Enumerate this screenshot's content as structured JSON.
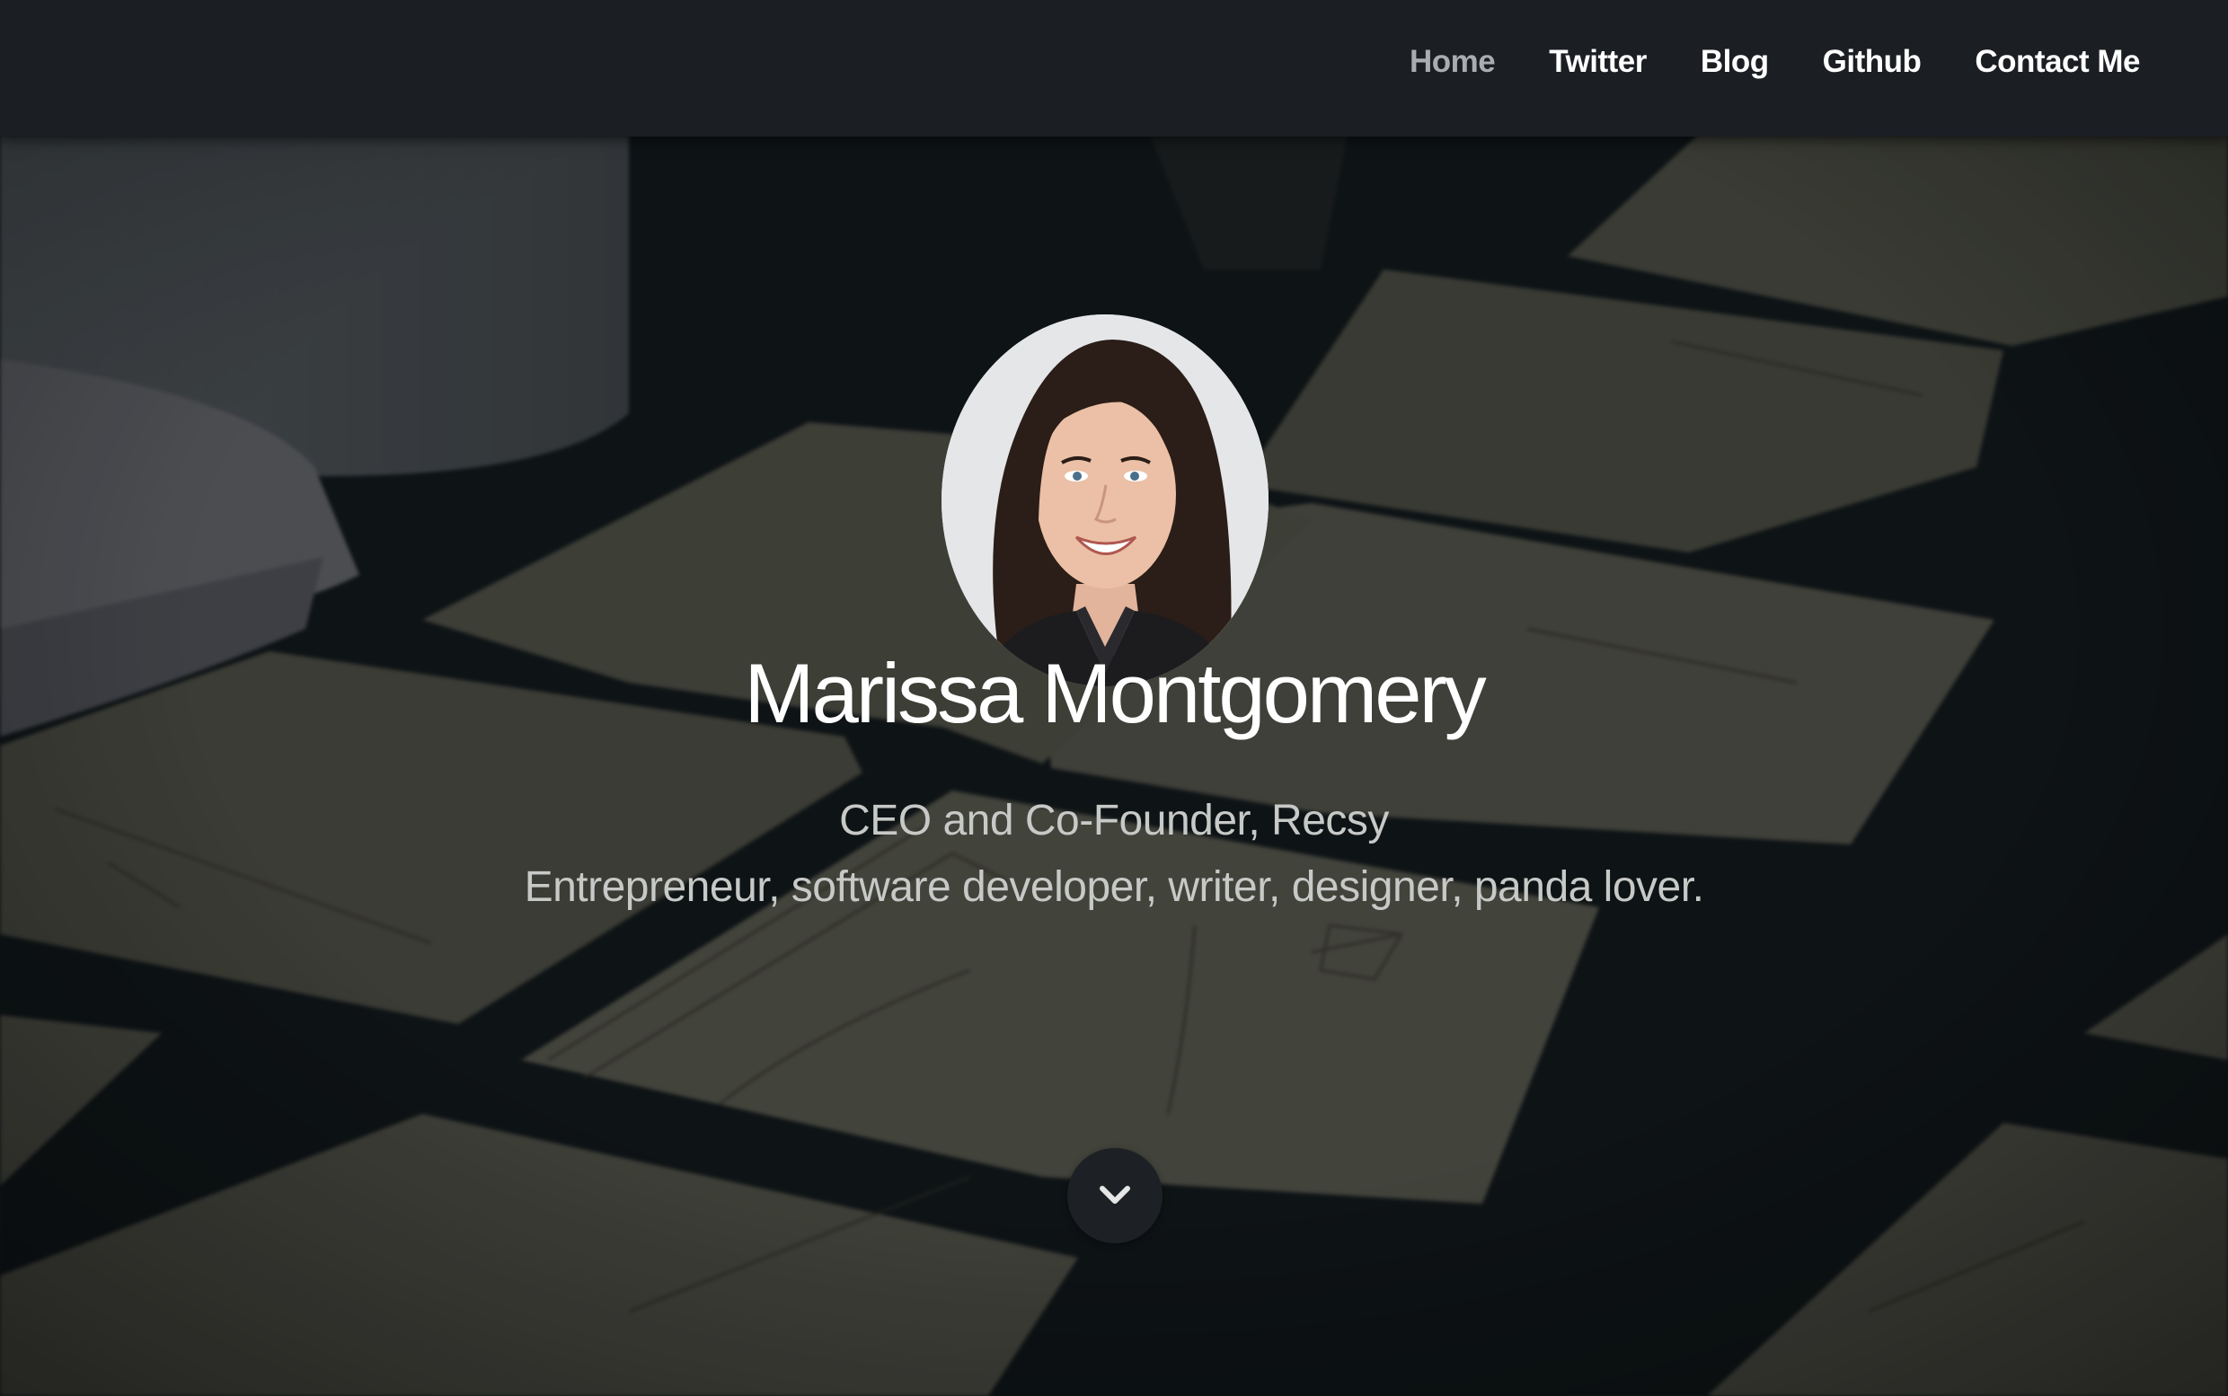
{
  "nav": {
    "items": [
      {
        "label": "Home",
        "active": true
      },
      {
        "label": "Twitter",
        "active": false
      },
      {
        "label": "Blog",
        "active": false
      },
      {
        "label": "Github",
        "active": false
      },
      {
        "label": "Contact Me",
        "active": false
      }
    ]
  },
  "hero": {
    "name": "Marissa Montgomery",
    "title_line": "CEO and Co-Founder, Recsy",
    "bio_line": "Entrepreneur, software developer, writer, designer, panda lover.",
    "scroll_icon": "chevron-down-icon"
  },
  "colors": {
    "navbar_bg": "#1b1e23",
    "nav_text": "#ffffff",
    "nav_active_text": "#a9acb0",
    "hero_text": "#ffffff",
    "tagline_text": "#c7c9c7",
    "scroll_button_bg": "#1d2024"
  }
}
